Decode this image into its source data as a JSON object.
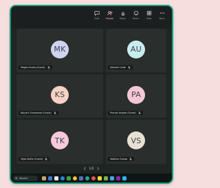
{
  "toolbar": {
    "buttons": [
      {
        "name": "chat",
        "label": "Chat",
        "icon": "chat-icon",
        "active": false
      },
      {
        "name": "people",
        "label": "People",
        "icon": "people-icon",
        "active": true
      },
      {
        "name": "raise",
        "label": "Raise",
        "icon": "raise-hand-icon",
        "active": false
      },
      {
        "name": "react",
        "label": "React",
        "icon": "react-icon",
        "active": false
      },
      {
        "name": "view",
        "label": "View",
        "icon": "view-icon",
        "active": false
      },
      {
        "name": "more",
        "label": "More",
        "icon": "more-icon",
        "active": false
      }
    ]
  },
  "participants": [
    {
      "initials": "MK",
      "name": "Megha Kudia (Guest)",
      "avatar_color": "#cfd3f2"
    },
    {
      "initials": "AU",
      "name": "Ashwini Unde",
      "avatar_color": "#c9ecef"
    },
    {
      "initials": "KS",
      "name": "Kalyani Sonawane (Guest)",
      "avatar_color": "#f7d2c4"
    },
    {
      "initials": "PA",
      "name": "Pranav Ashadi (Guest)",
      "avatar_color": "#f6c7d6"
    },
    {
      "initials": "TK",
      "name": "Tejas Kolhe (Guest)",
      "avatar_color": "#f6c9dc"
    },
    {
      "initials": "VS",
      "name": "Vaibhav Sonap",
      "avatar_color": "#e7e1d4"
    }
  ],
  "pager": {
    "label": "1/2"
  },
  "taskbar": {
    "search_label": "Search"
  },
  "colors": {
    "accent": "#13a07d",
    "background": "#f7dede"
  }
}
